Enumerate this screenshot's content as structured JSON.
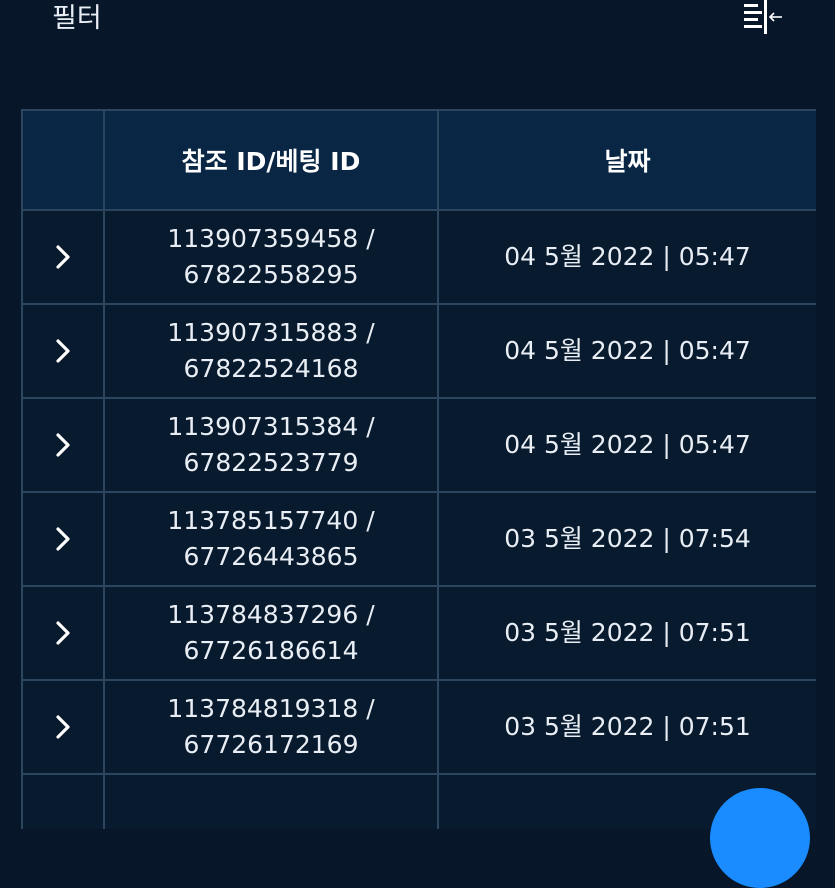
{
  "header": {
    "filter_label": "필터",
    "collapse_icon": "collapse-panel-icon"
  },
  "table": {
    "columns": [
      "",
      "참조 ID/베팅 ID",
      "날짜"
    ],
    "rows": [
      {
        "ref_id": "113907359458 /",
        "bet_id": "67822558295",
        "date": "04 5월 2022 | 05:47"
      },
      {
        "ref_id": "113907315883 /",
        "bet_id": "67822524168",
        "date": "04 5월 2022 | 05:47"
      },
      {
        "ref_id": "113907315384 /",
        "bet_id": "67822523779",
        "date": "04 5월 2022 | 05:47"
      },
      {
        "ref_id": "113785157740 /",
        "bet_id": "67726443865",
        "date": "03 5월 2022 | 07:54"
      },
      {
        "ref_id": "113784837296 /",
        "bet_id": "67726186614",
        "date": "03 5월 2022 | 07:51"
      },
      {
        "ref_id": "113784819318 /",
        "bet_id": "67726172169",
        "date": "03 5월 2022 | 07:51"
      }
    ]
  },
  "colors": {
    "background": "#071629",
    "header_bg": "#0a2645",
    "border": "#2c4660",
    "fab": "#1a8cff"
  }
}
